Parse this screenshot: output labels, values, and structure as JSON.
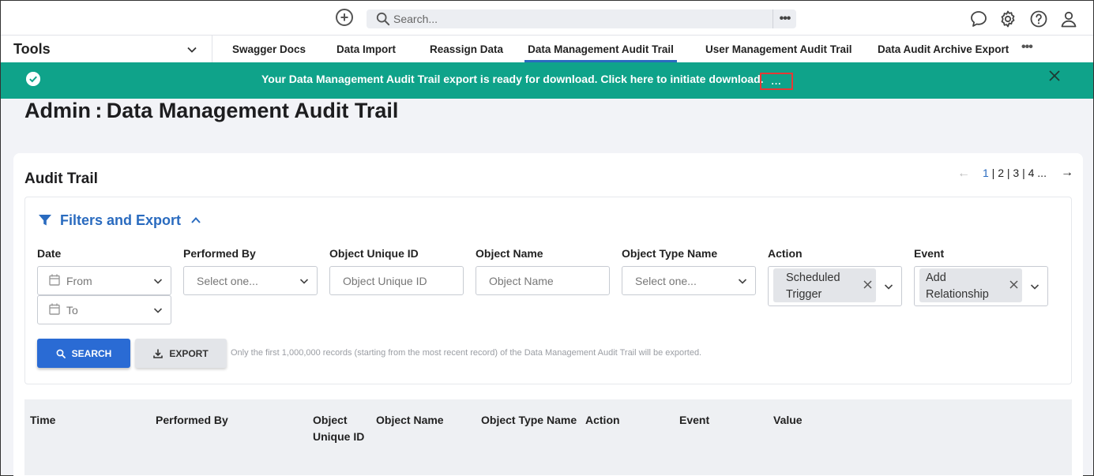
{
  "topbar": {
    "add_icon": "plus-circle-icon",
    "search": {
      "placeholder": "Search...",
      "more": "•••"
    },
    "icons": [
      "chat-icon",
      "gear-icon",
      "help-icon",
      "user-icon"
    ]
  },
  "nav": {
    "tools_label": "Tools",
    "tabs": [
      {
        "label": "Swagger Docs"
      },
      {
        "label": "Data Import"
      },
      {
        "label": "Reassign Data"
      },
      {
        "label": "Data Management Audit Trail",
        "active": true
      },
      {
        "label": "User Management Audit Trail"
      },
      {
        "label": "Data Audit Archive Export"
      }
    ],
    "more": "•••"
  },
  "banner": {
    "message": "Your Data Management Audit Trail export is ready for download. Click here to initiate download.",
    "dots": "...",
    "color": "#0fa38a"
  },
  "page": {
    "title": "Admin : Data Management Audit Trail"
  },
  "card": {
    "title": "Audit Trail",
    "pager": {
      "prev": "←",
      "current": "1",
      "rest": " | 2 | 3 | 4 ...",
      "next": "→"
    },
    "filters": {
      "heading": "Filters and Export",
      "date": {
        "label": "Date",
        "from": "From",
        "to": "To"
      },
      "performed_by": {
        "label": "Performed By",
        "placeholder": "Select one..."
      },
      "object_unique_id": {
        "label": "Object Unique ID",
        "placeholder": "Object Unique ID"
      },
      "object_name": {
        "label": "Object Name",
        "placeholder": "Object Name"
      },
      "object_type_name": {
        "label": "Object Type Name",
        "placeholder": "Select one..."
      },
      "action": {
        "label": "Action",
        "tag": "Scheduled Trigger"
      },
      "event": {
        "label": "Event",
        "tag": "Add Relationship"
      },
      "search_button": "SEARCH",
      "export_button": "EXPORT",
      "export_note": "Only the first 1,000,000 records (starting from the most recent record) of the Data Management Audit Trail will be exported."
    },
    "table": {
      "columns": [
        "Time",
        "Performed By",
        "Object Unique ID",
        "Object Name",
        "Object Type Name",
        "Action",
        "Event",
        "Value"
      ]
    }
  }
}
